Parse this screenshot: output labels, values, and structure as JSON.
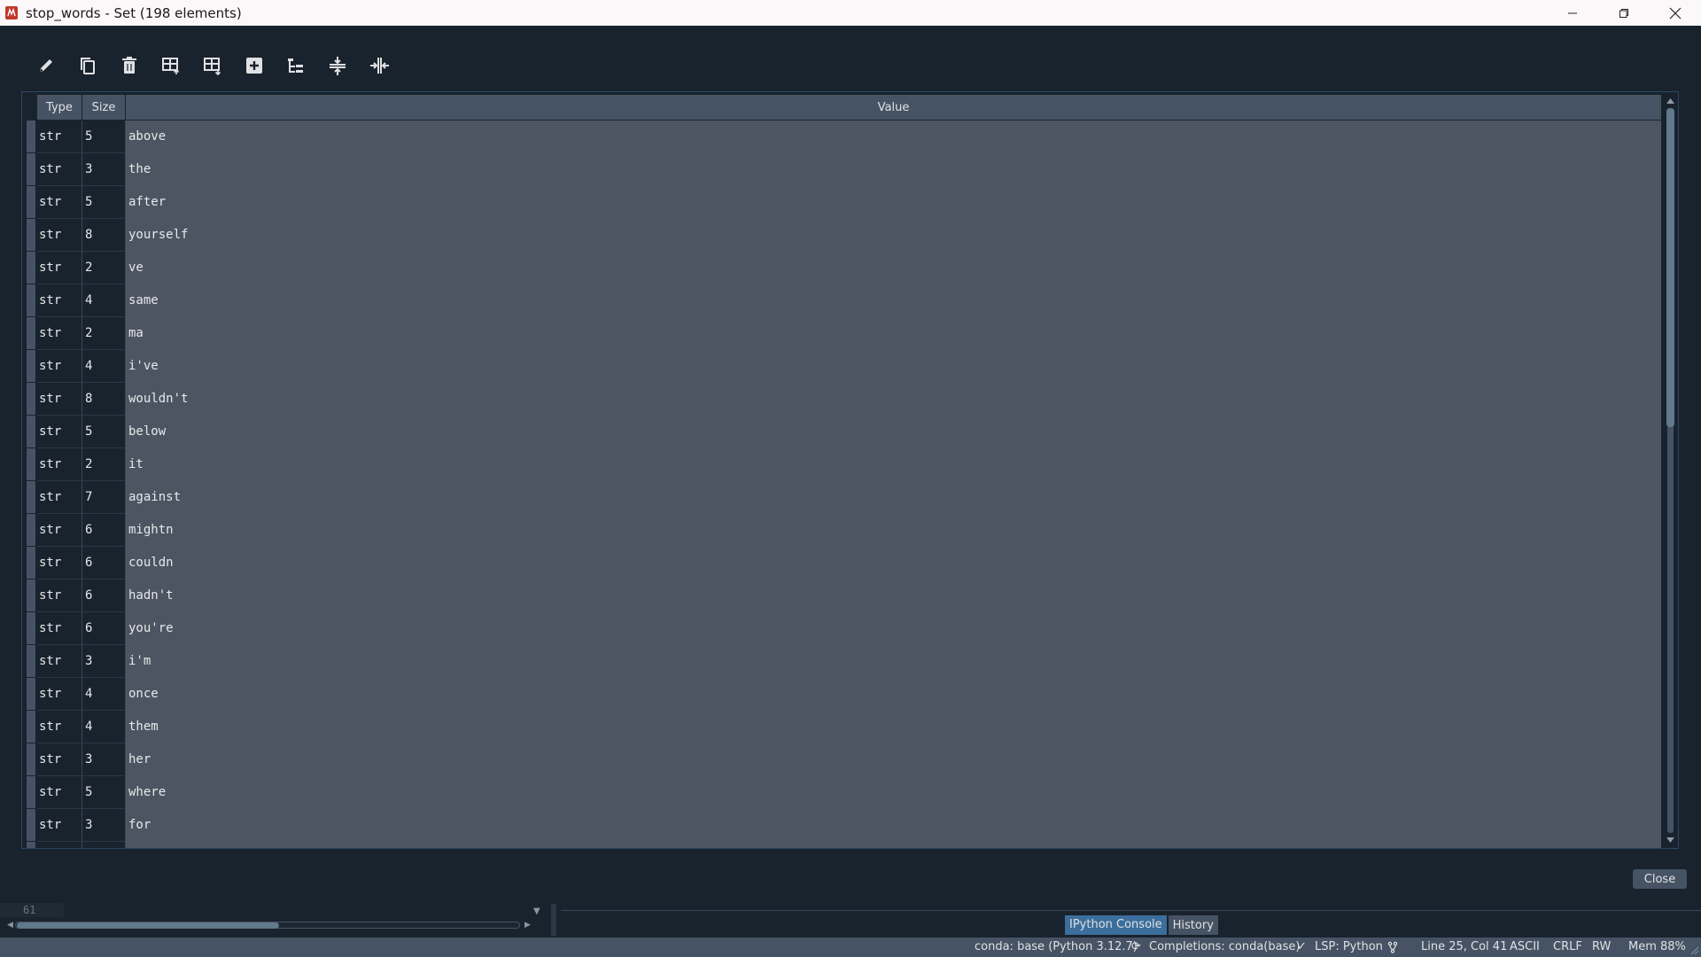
{
  "window": {
    "title": "stop_words - Set (198 elements)"
  },
  "toolbar": {
    "tools": [
      {
        "name": "edit",
        "icon": "pencil-icon"
      },
      {
        "name": "copy",
        "icon": "copy-icon"
      },
      {
        "name": "remove",
        "icon": "trash-icon"
      },
      {
        "name": "insert-above",
        "icon": "insert-row-above-icon"
      },
      {
        "name": "insert-below",
        "icon": "insert-row-below-icon"
      },
      {
        "name": "duplicate",
        "icon": "plus-square-icon"
      },
      {
        "name": "view-tree",
        "icon": "tree-icon"
      },
      {
        "name": "resize-rows",
        "icon": "resize-rows-icon"
      },
      {
        "name": "resize-columns",
        "icon": "resize-columns-icon"
      }
    ]
  },
  "table": {
    "headers": {
      "type": "Type",
      "size": "Size",
      "value": "Value"
    },
    "rows": [
      {
        "type": "str",
        "size": "5",
        "value": "above"
      },
      {
        "type": "str",
        "size": "3",
        "value": "the"
      },
      {
        "type": "str",
        "size": "5",
        "value": "after"
      },
      {
        "type": "str",
        "size": "8",
        "value": "yourself"
      },
      {
        "type": "str",
        "size": "2",
        "value": "ve"
      },
      {
        "type": "str",
        "size": "4",
        "value": "same"
      },
      {
        "type": "str",
        "size": "2",
        "value": "ma"
      },
      {
        "type": "str",
        "size": "4",
        "value": "i've"
      },
      {
        "type": "str",
        "size": "8",
        "value": "wouldn't"
      },
      {
        "type": "str",
        "size": "5",
        "value": "below"
      },
      {
        "type": "str",
        "size": "2",
        "value": "it"
      },
      {
        "type": "str",
        "size": "7",
        "value": "against"
      },
      {
        "type": "str",
        "size": "6",
        "value": "mightn"
      },
      {
        "type": "str",
        "size": "6",
        "value": "couldn"
      },
      {
        "type": "str",
        "size": "6",
        "value": "hadn't"
      },
      {
        "type": "str",
        "size": "6",
        "value": "you're"
      },
      {
        "type": "str",
        "size": "3",
        "value": "i'm"
      },
      {
        "type": "str",
        "size": "4",
        "value": "once"
      },
      {
        "type": "str",
        "size": "4",
        "value": "them"
      },
      {
        "type": "str",
        "size": "3",
        "value": "her"
      },
      {
        "type": "str",
        "size": "5",
        "value": "where"
      },
      {
        "type": "str",
        "size": "3",
        "value": "for"
      }
    ]
  },
  "dialog": {
    "close_label": "Close"
  },
  "editor": {
    "line_number": "61"
  },
  "tabs": {
    "ipython": "IPython Console",
    "history": "History"
  },
  "status": {
    "env": "conda: base (Python 3.12.7)",
    "completions": "Completions: conda(base)",
    "lsp": "LSP: Python",
    "position": "Line 25, Col 41",
    "encoding": "ASCII",
    "eol": "CRLF",
    "mode": "RW",
    "memory": "Mem 88%"
  },
  "colors": {
    "background": "#19232d",
    "panel": "#455364",
    "value_cell": "#4d5562",
    "accent": "#3b6e9c",
    "icon": "#e0e1e3"
  }
}
